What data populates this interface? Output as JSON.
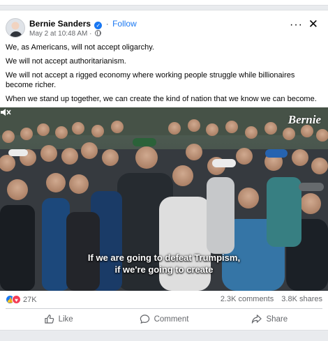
{
  "post": {
    "author": "Bernie Sanders",
    "follow_label": "Follow",
    "timestamp": "May 2 at 10:48 AM",
    "more_label": "···",
    "close_label": "✕",
    "paragraphs": [
      "We, as Americans, will not accept oligarchy.",
      "We will not accept authoritarianism.",
      "We will not accept a rigged economy where working people struggle while billionaires become richer.",
      "When we stand up together, we can create the kind of nation that we know we can become."
    ]
  },
  "video": {
    "watermark": "Bernie",
    "caption_line1": "If we are going to defeat Trumpism,",
    "caption_line2": "if we're going to create"
  },
  "stats": {
    "reaction_count": "27K",
    "comments": "2.3K comments",
    "shares": "3.8K shares"
  },
  "actions": {
    "like": "Like",
    "comment": "Comment",
    "share": "Share"
  },
  "icons": {
    "verified": "verified-badge-icon",
    "globe": "globe-icon",
    "like_reaction": "like-reaction-icon",
    "love_reaction": "love-reaction-icon",
    "mute": "mute-icon"
  },
  "colors": {
    "accent": "#1877f2",
    "love": "#f33e58",
    "muted_text": "#65676b"
  }
}
